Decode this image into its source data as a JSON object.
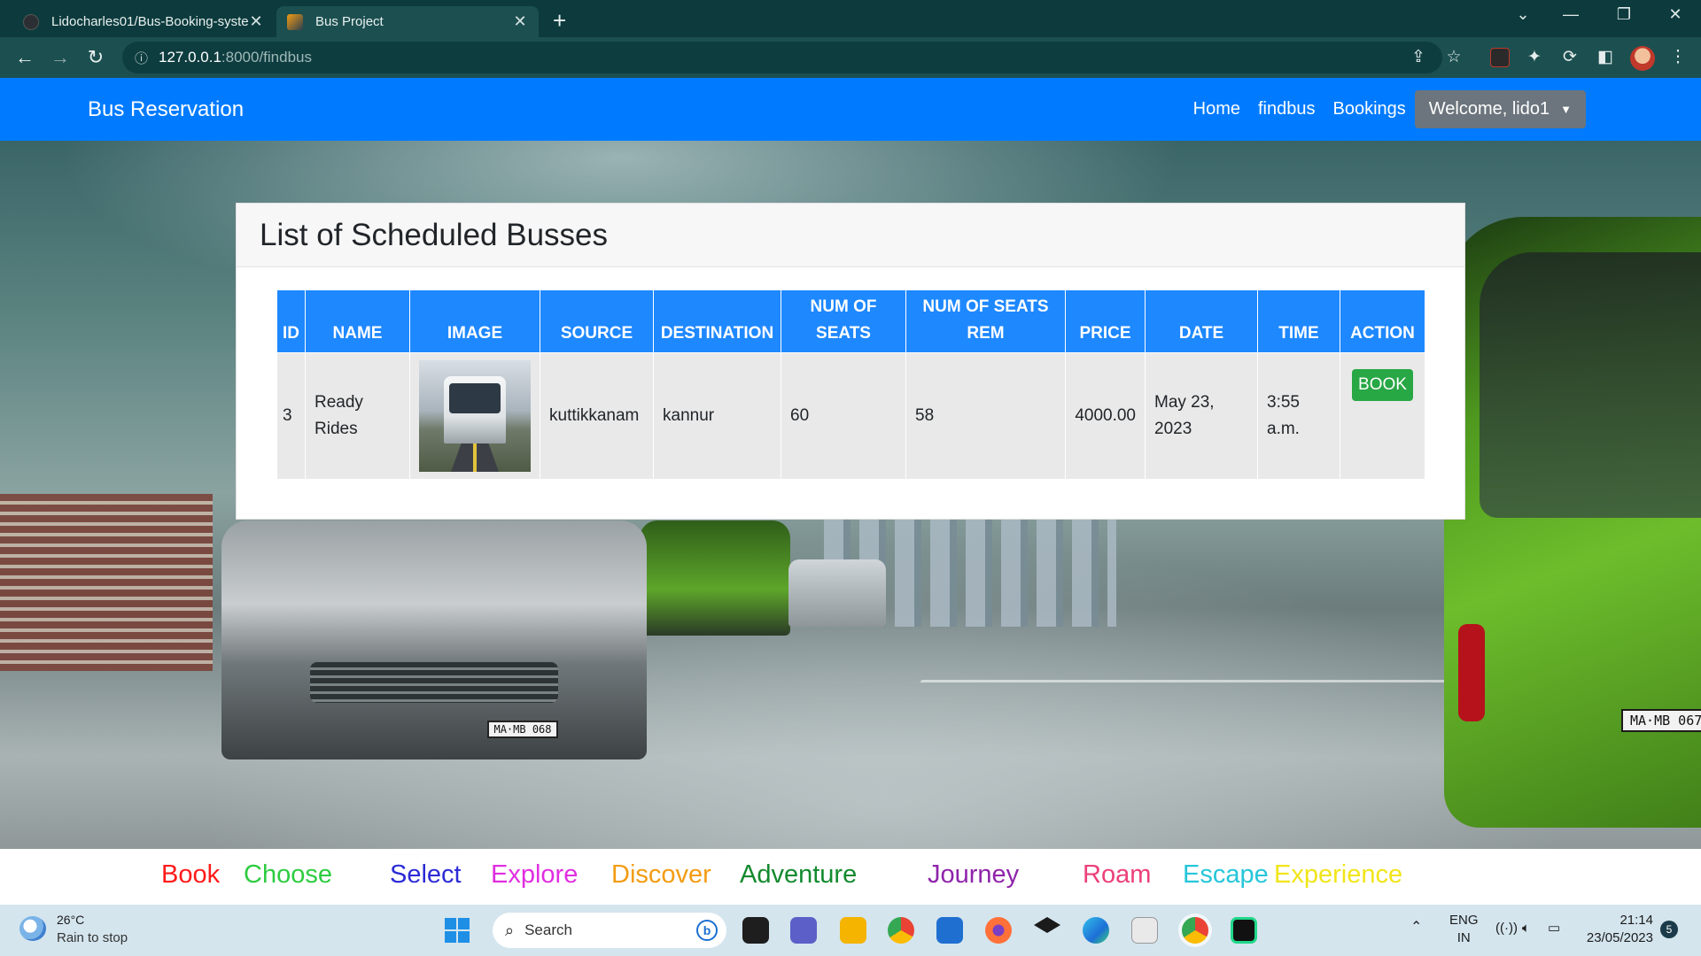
{
  "browser": {
    "tabs": [
      {
        "title": "Lidocharles01/Bus-Booking-syste",
        "active": false
      },
      {
        "title": "Bus Project",
        "active": true
      }
    ],
    "new_tab": "+",
    "url": {
      "host": "127.0.0.1",
      "path": ":8000/findbus"
    }
  },
  "navbar": {
    "brand": "Bus Reservation",
    "links": [
      "Home",
      "findbus",
      "Bookings"
    ],
    "user_menu": "Welcome, lido1",
    "color": "#007bff"
  },
  "card": {
    "title": "List of Scheduled Busses",
    "table": {
      "headers": [
        "ID",
        "NAME",
        "IMAGE",
        "SOURCE",
        "DESTINATION",
        "NUM OF SEATS",
        "NUM OF SEATS REM",
        "PRICE",
        "DATE",
        "TIME",
        "ACTION"
      ],
      "rows": [
        {
          "id": "3",
          "name": "Ready Rides",
          "source": "kuttikkanam",
          "destination": "kannur",
          "num_seats": "60",
          "num_seats_rem": "58",
          "price": "4000.00",
          "date": "May 23, 2023",
          "time": "3:55 a.m.",
          "action": "BOOK"
        }
      ]
    }
  },
  "background": {
    "plate_right": "MA·MB 067",
    "plate_left": "MA·MB 068"
  },
  "word_strip": [
    {
      "text": "Book",
      "color": "#ff1a1a"
    },
    {
      "text": "Choose",
      "color": "#2ecc40"
    },
    {
      "text": "Select",
      "color": "#2b2bd6"
    },
    {
      "text": "Explore",
      "color": "#e02ee0"
    },
    {
      "text": "Discover",
      "color": "#f39c12"
    },
    {
      "text": "Adventure",
      "color": "#138a2e"
    },
    {
      "text": "Journey",
      "color": "#8e24aa"
    },
    {
      "text": "Roam",
      "color": "#ec407a"
    },
    {
      "text": "Escape",
      "color": "#26c6da"
    },
    {
      "text": "Experience",
      "color": "#f1e51a"
    }
  ],
  "taskbar": {
    "weather_temp": "26°C",
    "weather_desc": "Rain to stop",
    "search_placeholder": "Search",
    "lang_top": "ENG",
    "lang_bottom": "IN",
    "time": "21:14",
    "date": "23/05/2023",
    "notifications": "5"
  }
}
